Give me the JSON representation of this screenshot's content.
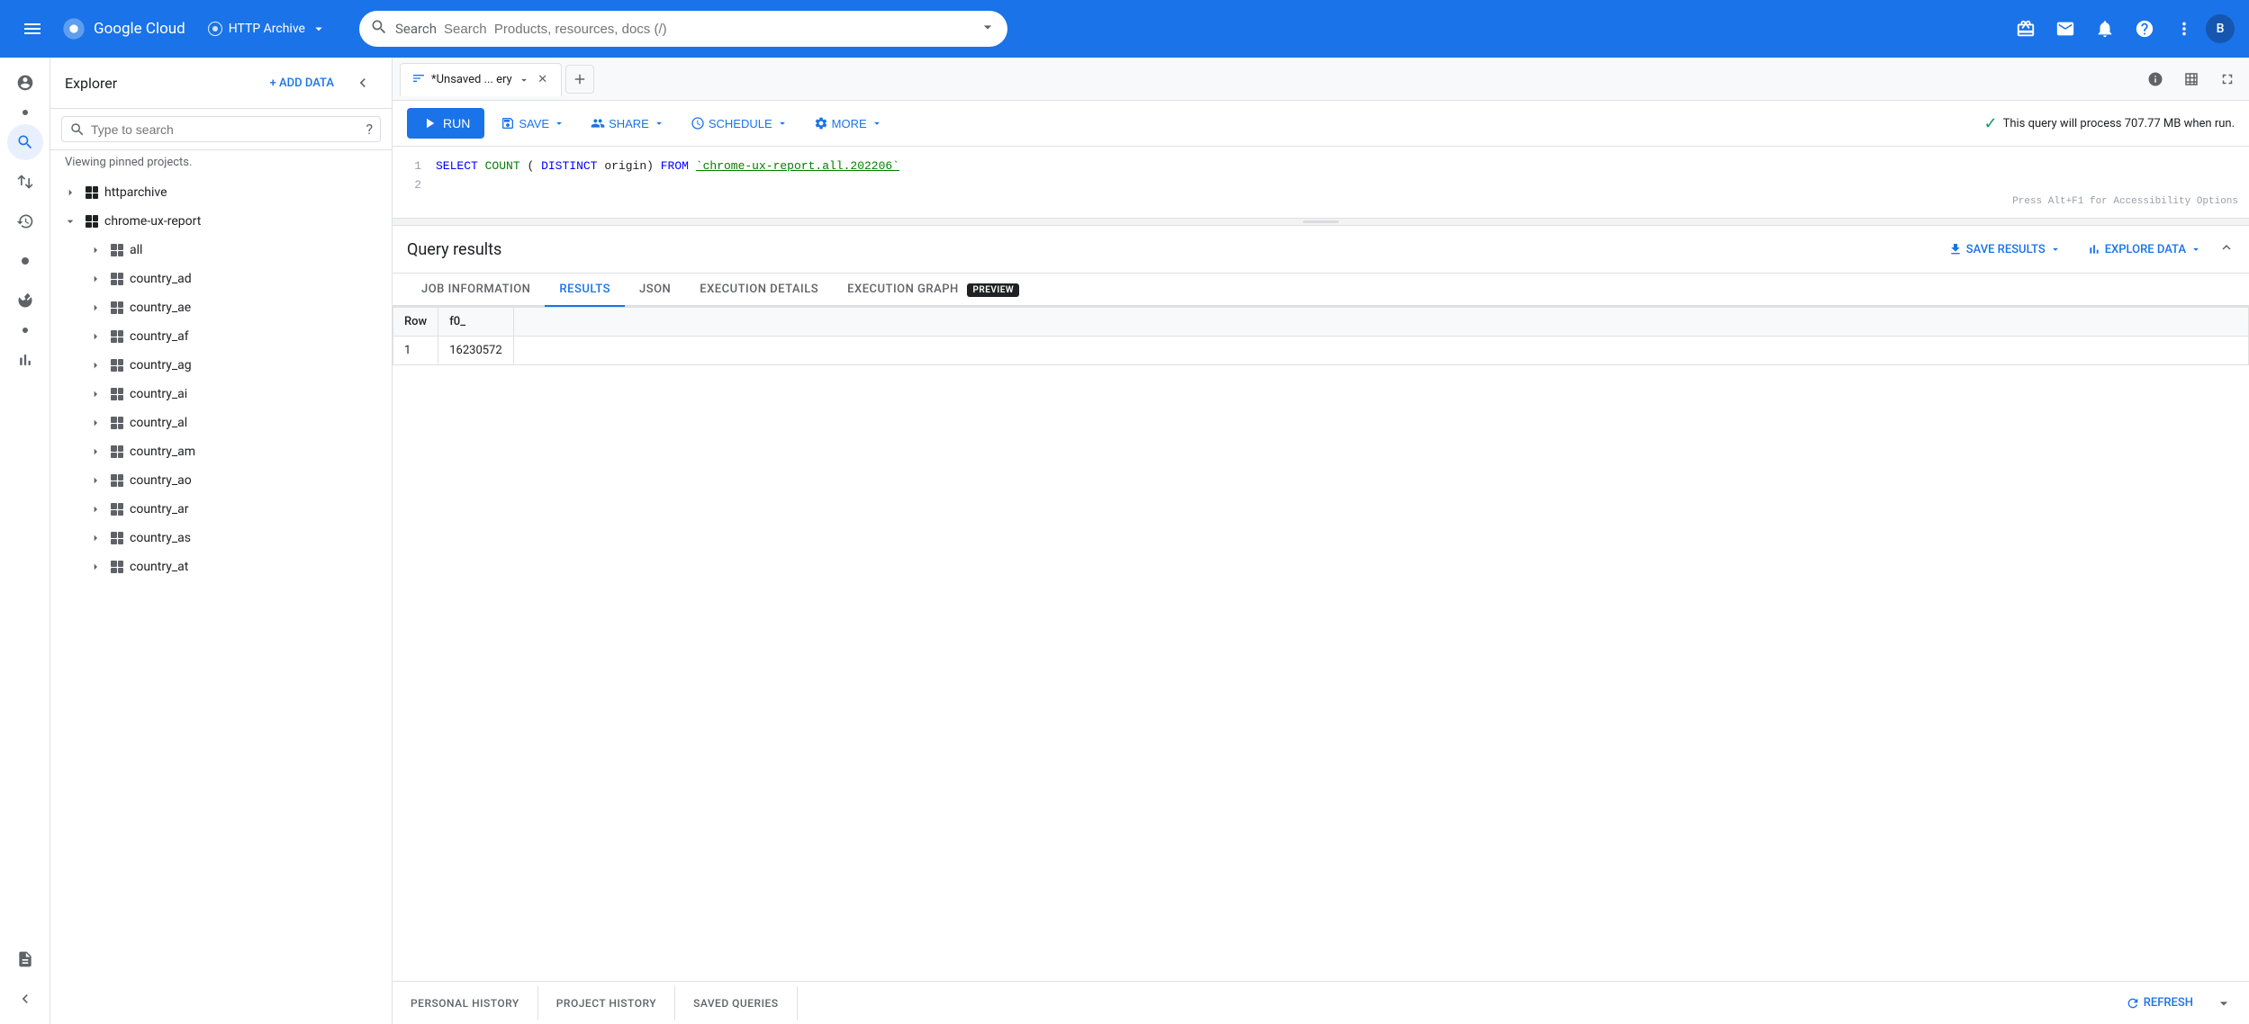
{
  "nav": {
    "hamburger_label": "Menu",
    "logo_text": "Google Cloud",
    "project_name": "HTTP Archive",
    "search_placeholder": "Search  Products, resources, docs (/)",
    "avatar_letter": "B"
  },
  "explorer": {
    "title": "Explorer",
    "add_data_label": "+ ADD DATA",
    "search_placeholder": "Type to search",
    "subtitle": "Viewing pinned projects.",
    "tree": [
      {
        "id": "httparchive",
        "label": "httparchive",
        "level": 0,
        "expanded": false
      },
      {
        "id": "chrome-ux-report",
        "label": "chrome-ux-report",
        "level": 0,
        "expanded": true,
        "pinned": true
      },
      {
        "id": "all",
        "label": "all",
        "level": 1
      },
      {
        "id": "country_ad",
        "label": "country_ad",
        "level": 1
      },
      {
        "id": "country_ae",
        "label": "country_ae",
        "level": 1
      },
      {
        "id": "country_af",
        "label": "country_af",
        "level": 1
      },
      {
        "id": "country_ag",
        "label": "country_ag",
        "level": 1
      },
      {
        "id": "country_ai",
        "label": "country_ai",
        "level": 1
      },
      {
        "id": "country_al",
        "label": "country_al",
        "level": 1
      },
      {
        "id": "country_am",
        "label": "country_am",
        "level": 1
      },
      {
        "id": "country_ao",
        "label": "country_ao",
        "level": 1
      },
      {
        "id": "country_ar",
        "label": "country_ar",
        "level": 1
      },
      {
        "id": "country_as",
        "label": "country_as",
        "level": 1
      },
      {
        "id": "country_at",
        "label": "country_at",
        "level": 1
      }
    ]
  },
  "query_tab": {
    "label": "*Unsaved ... ery",
    "close_label": "×"
  },
  "toolbar": {
    "run_label": "RUN",
    "save_label": "SAVE",
    "share_label": "SHARE",
    "schedule_label": "SCHEDULE",
    "more_label": "MORE",
    "size_info": "This query will process 707.77 MB when run."
  },
  "editor": {
    "lines": [
      {
        "num": "1",
        "content": "SELECT COUNT(DISTINCT origin) FROM `chrome-ux-report.all.202206`"
      },
      {
        "num": "2",
        "content": ""
      }
    ],
    "accessibility_hint": "Press Alt+F1 for Accessibility Options"
  },
  "results": {
    "title": "Query results",
    "save_results_label": "SAVE RESULTS",
    "explore_data_label": "EXPLORE DATA",
    "tabs": [
      {
        "id": "job-information",
        "label": "JOB INFORMATION",
        "active": false
      },
      {
        "id": "results",
        "label": "RESULTS",
        "active": true
      },
      {
        "id": "json",
        "label": "JSON",
        "active": false
      },
      {
        "id": "execution-details",
        "label": "EXECUTION DETAILS",
        "active": false
      },
      {
        "id": "execution-graph",
        "label": "EXECUTION GRAPH",
        "active": false,
        "badge": "PREVIEW"
      }
    ],
    "table": {
      "headers": [
        "Row",
        "f0_"
      ],
      "rows": [
        [
          "1",
          "16230572"
        ]
      ]
    }
  },
  "history": {
    "tabs": [
      {
        "id": "personal-history",
        "label": "PERSONAL HISTORY"
      },
      {
        "id": "project-history",
        "label": "PROJECT HISTORY"
      },
      {
        "id": "saved-queries",
        "label": "SAVED QUERIES"
      }
    ],
    "refresh_label": "REFRESH"
  }
}
